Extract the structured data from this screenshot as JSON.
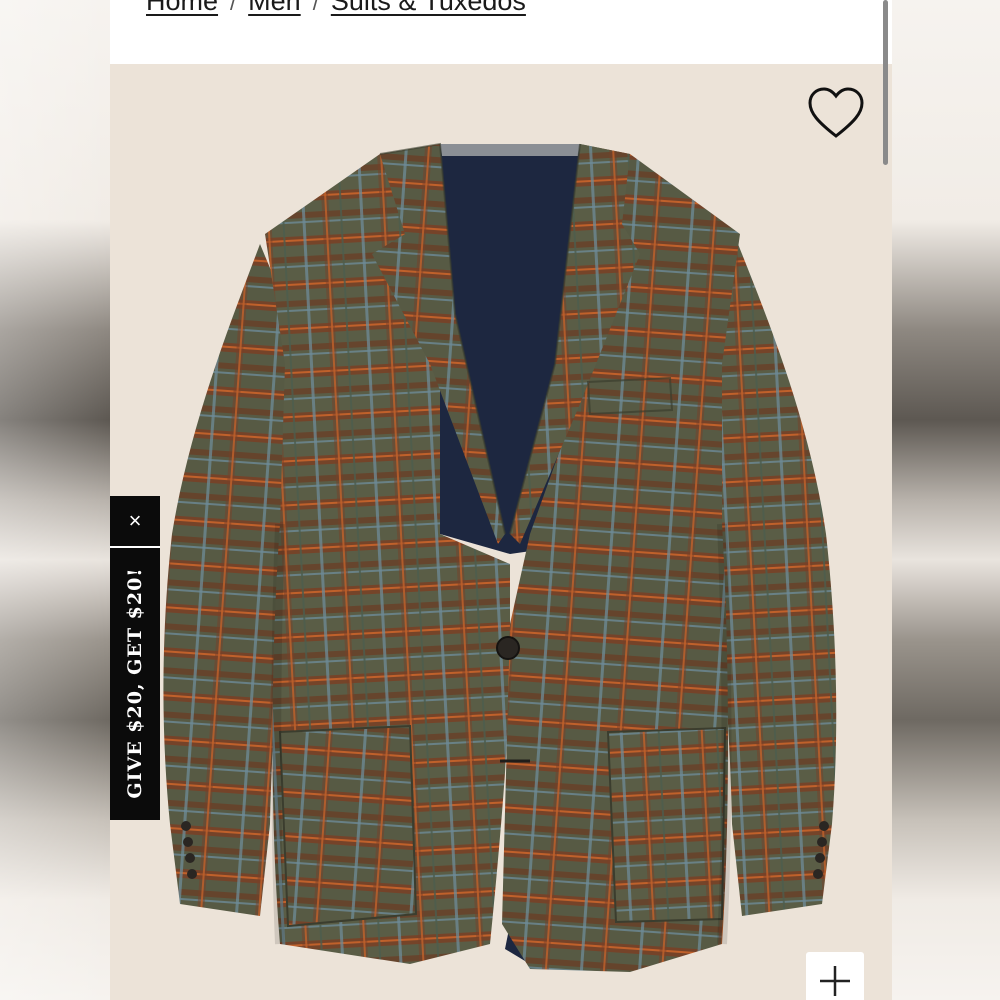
{
  "breadcrumb": {
    "items": [
      "Home",
      "Men",
      "Suits & Tuxedos"
    ],
    "separator": "/"
  },
  "product": {
    "image": "plaid-tweed-blazer-image",
    "background_color": "#ece3d8",
    "fabric_colors": {
      "base_green": "#5a5d46",
      "rust": "#9a4a24",
      "orange_stripe": "#c0612b",
      "blue_stripe": "#6d8a96",
      "lining_navy": "#1d2740"
    }
  },
  "favorite": {
    "icon": "heart-icon"
  },
  "promo": {
    "label": "GIVE $20, GET $20!",
    "close_symbol": "×"
  },
  "zoom": {
    "icon": "plus-icon"
  }
}
